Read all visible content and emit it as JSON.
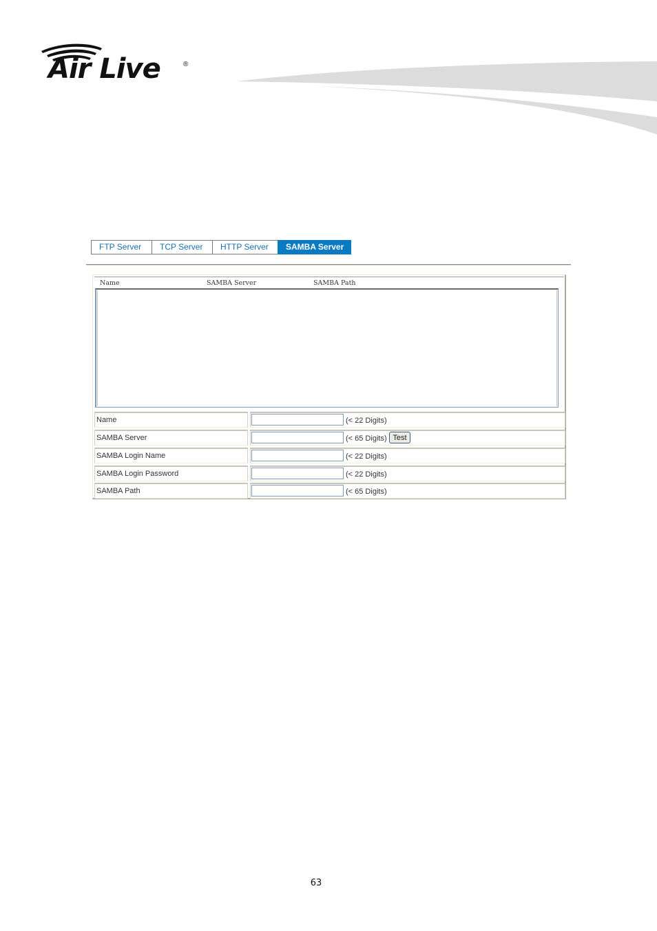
{
  "brand": {
    "logo_text": "Air Live",
    "registered_mark": "®"
  },
  "tabs": [
    {
      "label": "FTP Server",
      "active": false
    },
    {
      "label": "TCP Server",
      "active": false
    },
    {
      "label": "HTTP Server",
      "active": false
    },
    {
      "label": "SAMBA Server",
      "active": true
    }
  ],
  "colors": {
    "active_tab_bg": "#0a7ac2",
    "tab_text": "#1a6fb0",
    "swoosh": "#dcdcdc"
  },
  "server_list": {
    "columns": [
      "Name",
      "SAMBA Server",
      "SAMBA Path"
    ],
    "rows": []
  },
  "form": {
    "fields": [
      {
        "label": "Name",
        "value": "",
        "hint": "(< 22 Digits)"
      },
      {
        "label": "SAMBA Server",
        "value": "",
        "hint": "(< 65 Digits)",
        "button": "Test"
      },
      {
        "label": "SAMBA Login Name",
        "value": "",
        "hint": "(< 22 Digits)"
      },
      {
        "label": "SAMBA Login Password",
        "value": "",
        "hint": "(< 22 Digits)"
      },
      {
        "label": "SAMBA Path",
        "value": "",
        "hint": "(< 65 Digits)"
      }
    ]
  },
  "footer": {
    "page_number": "63"
  }
}
